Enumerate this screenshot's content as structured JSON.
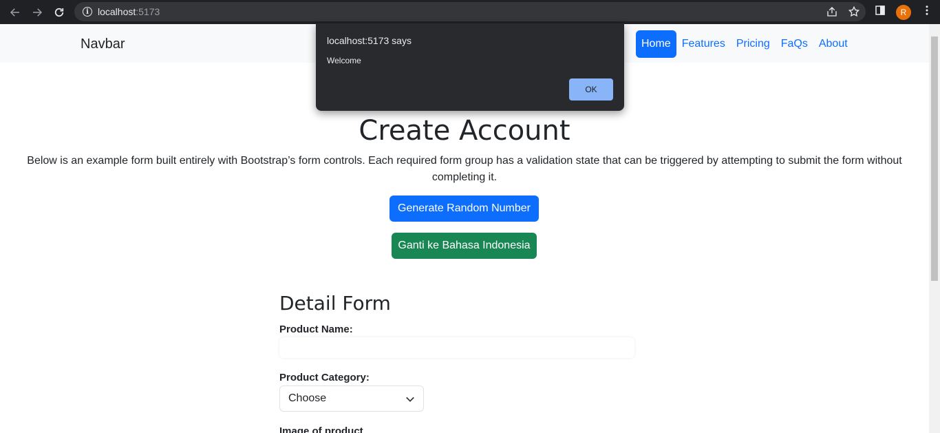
{
  "browser": {
    "url_host": "localhost",
    "url_port": ":5173",
    "profile_initial": "R"
  },
  "navbar": {
    "brand": "Navbar",
    "links": [
      "Home",
      "Features",
      "Pricing",
      "FaQs",
      "About"
    ],
    "active_link": "Home"
  },
  "hero": {
    "title": "Create Account",
    "description": "Below is an example form built entirely with Bootstrap’s form controls. Each required form group has a validation state that can be triggered by attempting to submit the form without completing it.",
    "random_button": "Generate Random Number",
    "language_button": "Ganti ke Bahasa Indonesia"
  },
  "form": {
    "title": "Detail Form",
    "product_name_label": "Product Name:",
    "product_name_value": "",
    "product_category_label": "Product Category:",
    "product_category_selected": "Choose",
    "image_label": "Image of product"
  },
  "dialog": {
    "title": "localhost:5173 says",
    "message": "Welcome",
    "ok_label": "OK"
  },
  "colors": {
    "primary": "#0d6efd",
    "success": "#198754",
    "dialog_bg": "#292a2d",
    "dialog_button": "#8ab4f8"
  }
}
